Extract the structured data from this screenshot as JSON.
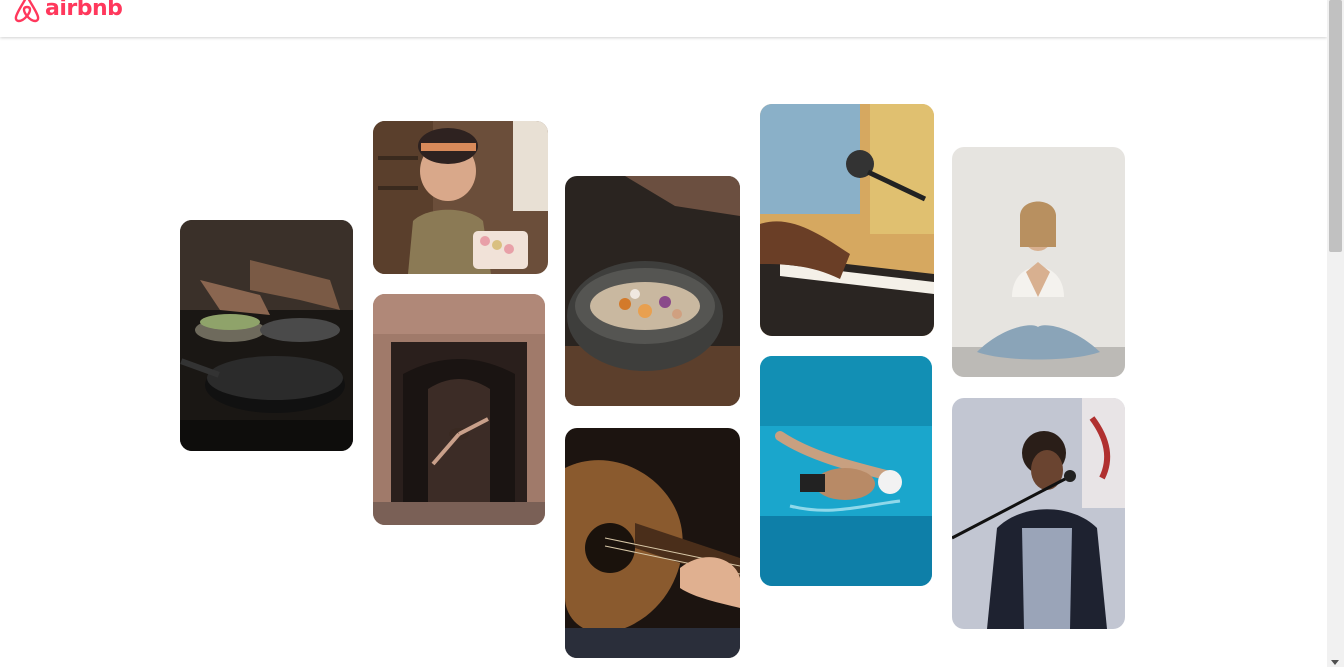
{
  "header": {
    "logo_text": "airbnb",
    "logo_icon": "airbnb-belo-icon",
    "brand_color": "#ff385c"
  },
  "gallery": {
    "photos": [
      {
        "id": "cooking-pans",
        "subject": "cooking-pans-photo"
      },
      {
        "id": "woman-macarons",
        "subject": "woman-holding-macarons-photo"
      },
      {
        "id": "dancer-archway",
        "subject": "dancer-in-archway-photo"
      },
      {
        "id": "food-bowl",
        "subject": "seasoning-food-bowl-photo"
      },
      {
        "id": "guitar",
        "subject": "acoustic-guitar-photo"
      },
      {
        "id": "piano-mic",
        "subject": "piano-and-microphone-photo"
      },
      {
        "id": "swimmer",
        "subject": "swimmer-in-pool-photo"
      },
      {
        "id": "yoga",
        "subject": "woman-meditating-yoga-photo"
      },
      {
        "id": "singer",
        "subject": "singer-with-microphone-photo"
      }
    ]
  }
}
